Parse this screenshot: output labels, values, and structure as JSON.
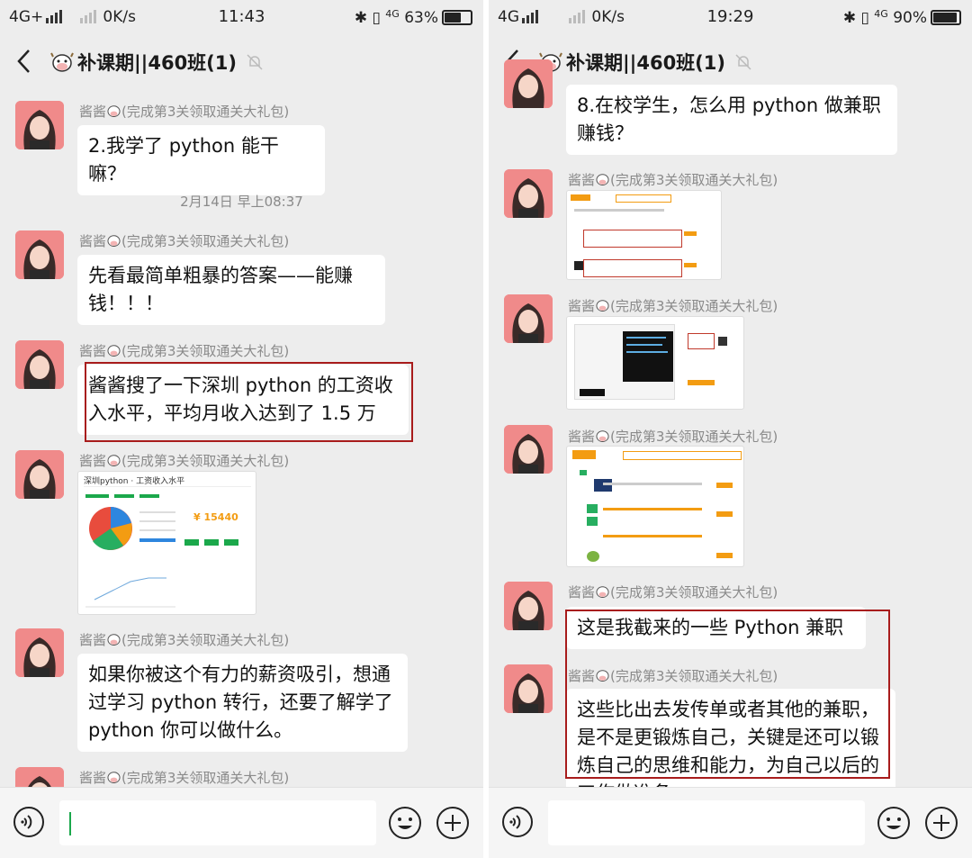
{
  "left": {
    "status": {
      "network": "4G+",
      "speed": "0K/s",
      "time": "11:43",
      "network2": "4G",
      "battery": "63%"
    },
    "title": "补课期||460班(1)",
    "sender": "酱酱",
    "sender_note": "(完成第3关领取通关大礼包)",
    "messages": [
      {
        "text": "2.我学了 python 能干嘛？"
      },
      {
        "text": "先看最简单粗暴的答案——能赚钱！！！"
      },
      {
        "text": "酱酱搜了一下深圳 python 的工资收入水平，平均月收入达到了 1.5 万"
      },
      {
        "text": "如果你被这个有力的薪资吸引，想通过学习 python 转行，还要了解学了 python 你可以做什么。"
      }
    ],
    "timestamp": "2月14日 早上08:37",
    "salary_card": {
      "heading": "深圳python · 工资收入水平",
      "amount": "¥ 15440"
    }
  },
  "right": {
    "status": {
      "network": "4G",
      "speed": "0K/s",
      "time": "19:29",
      "network2": "4G",
      "battery": "90%"
    },
    "title": "补课期||460班(1)",
    "sender": "酱酱",
    "sender_note": "(完成第3关领取通关大礼包)",
    "messages": [
      {
        "text": "8.在校学生，怎么用 python 做兼职赚钱？"
      },
      {
        "text": "这是我截来的一些 Python 兼职"
      },
      {
        "text": "这些比出去发传单或者其他的兼职，是不是更锻炼自己，关键是还可以锻炼自己的思维和能力，为自己以后的工作做准备"
      }
    ]
  },
  "colors": {
    "highlight": "#a81c1c",
    "caret": "#1ba84b",
    "chat_bg": "#ededed"
  }
}
